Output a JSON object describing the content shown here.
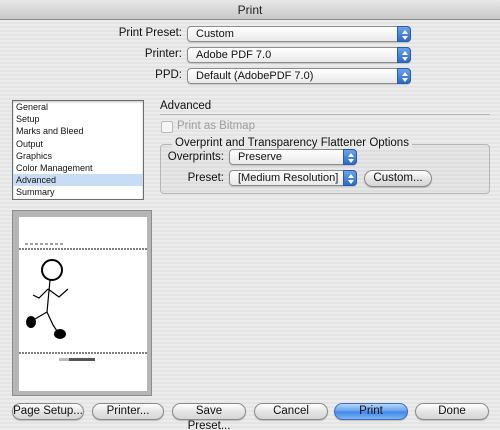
{
  "window": {
    "title": "Print"
  },
  "top_settings": {
    "print_preset_label": "Print Preset:",
    "print_preset_value": "Custom",
    "printer_label": "Printer:",
    "printer_value": "Adobe PDF 7.0",
    "ppd_label": "PPD:",
    "ppd_value": "Default (AdobePDF 7.0)"
  },
  "sidebar": {
    "items": [
      {
        "label": "General"
      },
      {
        "label": "Setup"
      },
      {
        "label": "Marks and Bleed"
      },
      {
        "label": "Output"
      },
      {
        "label": "Graphics"
      },
      {
        "label": "Color Management"
      },
      {
        "label": "Advanced",
        "selected": true
      },
      {
        "label": "Summary"
      }
    ]
  },
  "advanced": {
    "section_title": "Advanced",
    "print_as_bitmap_label": "Print as Bitmap",
    "print_as_bitmap_checked": false,
    "flattener_group_title": "Overprint and Transparency Flattener Options",
    "overprints_label": "Overprints:",
    "overprints_value": "Preserve",
    "preset_label": "Preset:",
    "preset_value": "[Medium Resolution]",
    "custom_button": "Custom..."
  },
  "buttons": {
    "page_setup": "Page Setup...",
    "printer": "Printer...",
    "save_preset": "Save Preset...",
    "cancel": "Cancel",
    "print": "Print",
    "done": "Done"
  },
  "colors": {
    "accent_blue": "#3d86e8",
    "selection": "#c9dcf6"
  },
  "icons": {
    "popup_arrows": "updown-arrows-icon",
    "preview": "stick-figure-page-preview"
  }
}
